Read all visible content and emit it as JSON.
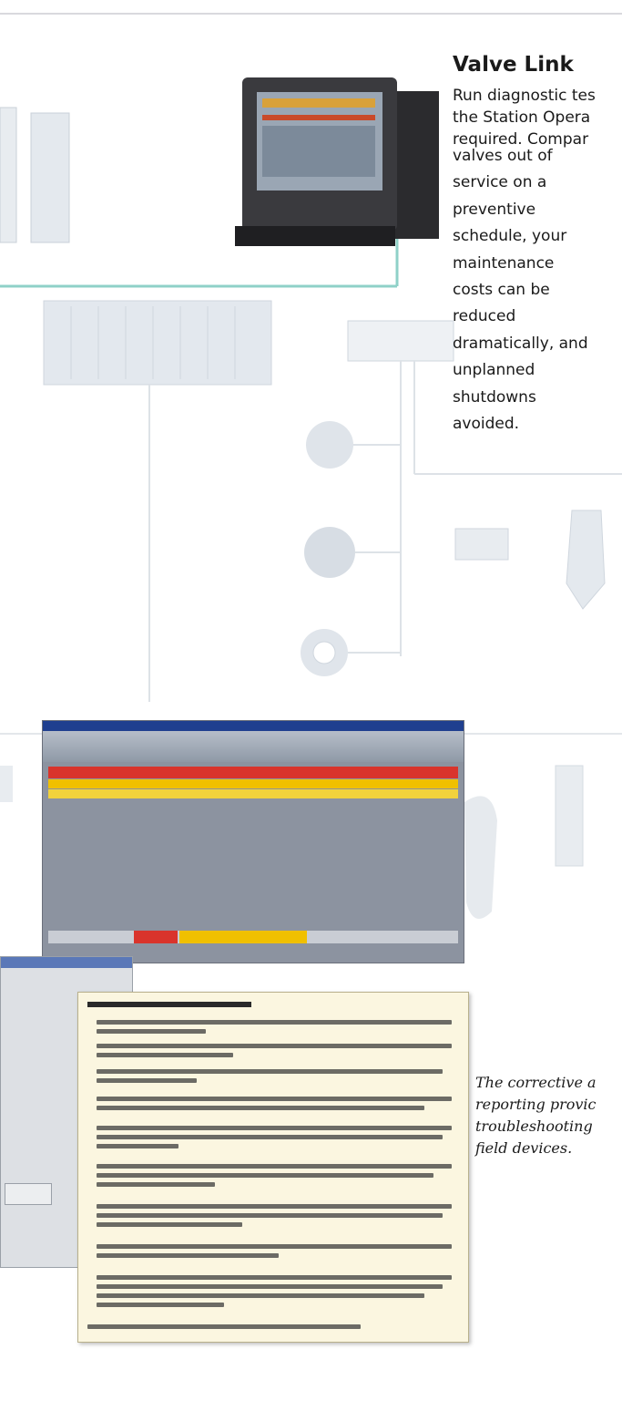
{
  "valve_link": {
    "heading": "Valve Link",
    "wide_lines": [
      "Run diagnostic tes",
      "the Station Opera",
      "required. Compar"
    ],
    "narrow_lines": [
      "valves out of",
      "service on a",
      "preventive",
      "schedule, your",
      "maintenance",
      "costs can be",
      "reduced",
      "dramatically, and",
      "unplanned",
      "shutdowns",
      "avoided."
    ]
  },
  "caption": {
    "lines": [
      "The corrective a",
      "reporting provic",
      "troubleshooting",
      "field devices."
    ]
  },
  "colors": {
    "network_line": "#8fd1c8",
    "device_fill": "#e3e8ee",
    "alarm_red": "#d9342c",
    "alarm_yellow": "#f0c000",
    "note_bg": "#fbf6e0"
  }
}
